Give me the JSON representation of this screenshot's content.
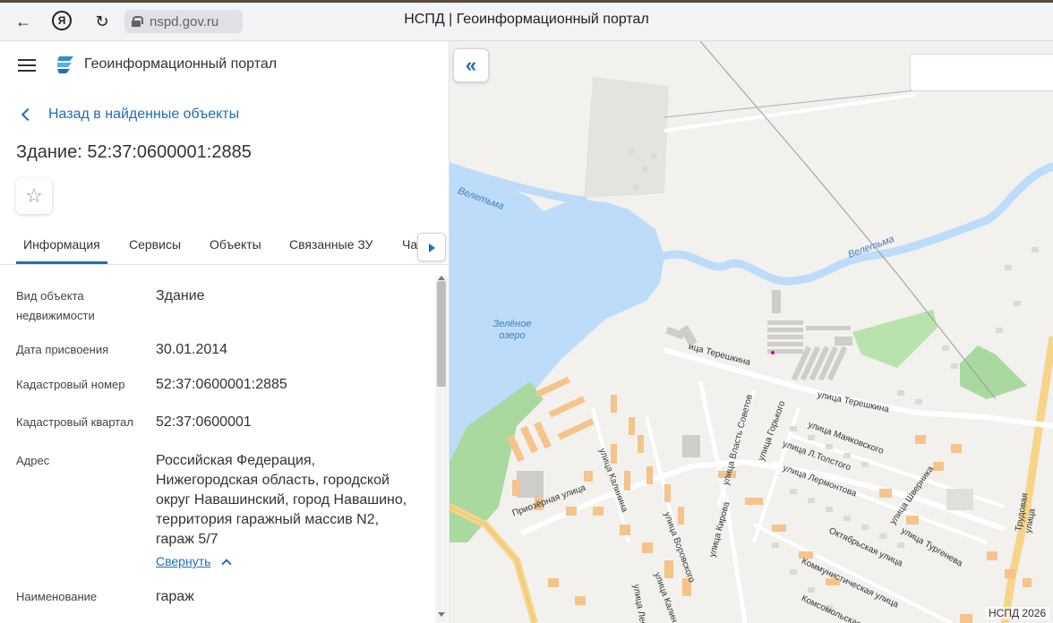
{
  "browser": {
    "back_icon": "back-arrow-icon",
    "yandex_label": "Я",
    "reload_icon": "reload-icon",
    "url": "nspd.gov.ru",
    "title": "НСПД | Геоинформационный портал"
  },
  "header": {
    "portal_name": "Геоинформационный портал",
    "menu_icon": "hamburger-icon"
  },
  "back_link": "Назад в найденные объекты",
  "object_title": "Здание: 52:37:0600001:2885",
  "tabs": [
    {
      "label": "Информация",
      "active": true
    },
    {
      "label": "Сервисы"
    },
    {
      "label": "Объекты"
    },
    {
      "label": "Связанные ЗУ"
    },
    {
      "label": "Ча"
    }
  ],
  "info": {
    "object_type": {
      "label": "Вид объекта недвижимости",
      "value": "Здание"
    },
    "assign_date": {
      "label": "Дата присвоения",
      "value": "30.01.2014"
    },
    "cadastral_number": {
      "label": "Кадастровый номер",
      "value": "52:37:0600001:2885"
    },
    "cadastral_block": {
      "label": "Кадастровый квартал",
      "value": "52:37:0600001"
    },
    "address": {
      "label": "Адрес",
      "value": "Российская Федерация, Нижегородская область, городской округ Навашинский, город Навашино, территория гаражный массив N2, гараж 5/7"
    },
    "collapse_label": "Свернуть",
    "name": {
      "label": "Наименование",
      "value": "гараж"
    }
  },
  "map": {
    "labels": {
      "river1": "Велетьма",
      "river2": "Велетьма",
      "lake": "Зелёное озеро",
      "tereshkina1": "ица Терешкина",
      "tereshkina2": "улица Терешкина",
      "mayakovskogo": "улица Маяковского",
      "tolstogo": "улица Л.Толстого",
      "lermontova": "улица Лермонтова",
      "gorkogo": "улица Горького",
      "vlast_sovetov": "улица Власть Советов",
      "kirova": "улица Кирова",
      "vorovskogo": "улица Воровского",
      "kalinina": "улица Калинина",
      "priozernaya": "Приозёрная улица",
      "oktyabrskaya": "Октябрьская улица",
      "kommunisticheskaya": "Коммунистическая улица",
      "komsomolskaya": "Комсомольская",
      "shvernika": "улица Шверника",
      "turgeneva": "улица Тургенева",
      "trudovaya": "Трудовая улица",
      "kalinina2": "улица Калин",
      "leo": "улица Лео"
    },
    "copyright": "НСПД 2026",
    "colors": {
      "water": "#bcdcfa",
      "park": "#a9d99f",
      "building": "#f5c48a"
    }
  }
}
